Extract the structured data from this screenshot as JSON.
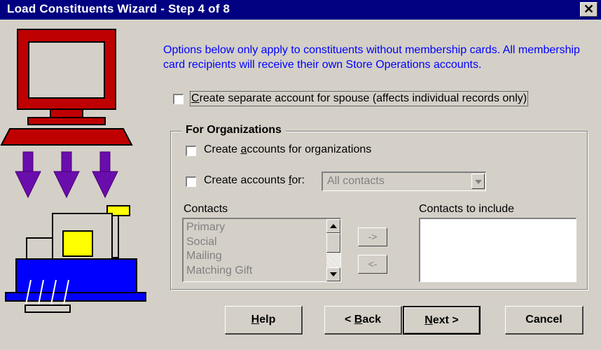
{
  "window": {
    "title": "Load Constituents Wizard - Step 4 of 8",
    "close_glyph": "✕"
  },
  "info_text": "Options below only apply to constituents without membership cards.  All membership card recipients will receive their own Store Operations accounts.",
  "spouse_option": {
    "label_pre": "",
    "label_accel": "C",
    "label_post": "reate separate account for spouse   (affects individual records only)",
    "checked": false
  },
  "organizations": {
    "group_title": "For Organizations",
    "create_org_accounts": {
      "label_pre": "Create ",
      "label_accel": "a",
      "label_post": "ccounts for organizations",
      "checked": false
    },
    "create_accounts_for": {
      "label_pre": "Create accounts ",
      "label_accel": "f",
      "label_post": "or:",
      "checked": false
    },
    "contacts_dropdown": {
      "selected": "All contacts"
    },
    "contacts_label": "Contacts",
    "contacts": [
      "Primary",
      "Social",
      "Mailing",
      "Matching Gift"
    ],
    "contacts_to_include_label": "Contacts to include",
    "contacts_to_include": [],
    "add_button": "->",
    "remove_button": "<-"
  },
  "buttons": {
    "help": {
      "accel": "H",
      "rest": "elp"
    },
    "back": {
      "pre": "< ",
      "accel": "B",
      "rest": "ack"
    },
    "next": {
      "accel": "N",
      "rest": "ext >"
    },
    "cancel": {
      "label": "Cancel"
    }
  },
  "icons": {
    "wizard_art": "computer-to-register-icon"
  },
  "colors": {
    "titlebar": "#000080",
    "info_text": "#0000ff",
    "window_bg": "#d4d0c8"
  }
}
